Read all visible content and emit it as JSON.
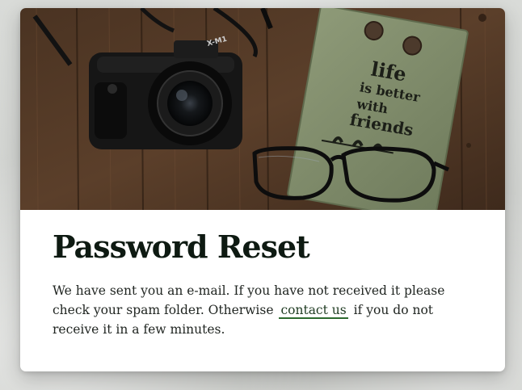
{
  "card": {
    "title": "Password Reset",
    "message_before": "We have sent you an e-mail. If you have not received it please check your spam folder. Otherwise",
    "link_label": "contact us",
    "message_after": "if you do not receive it in a few minutes."
  },
  "hero_image": {
    "camera_brand": "X-M1",
    "notebook_text": [
      "life",
      "is better",
      "with",
      "friends"
    ]
  },
  "colors": {
    "title": "#0e1a12",
    "link_underline": "#2d6a2f",
    "card_background": "#ffffff"
  }
}
